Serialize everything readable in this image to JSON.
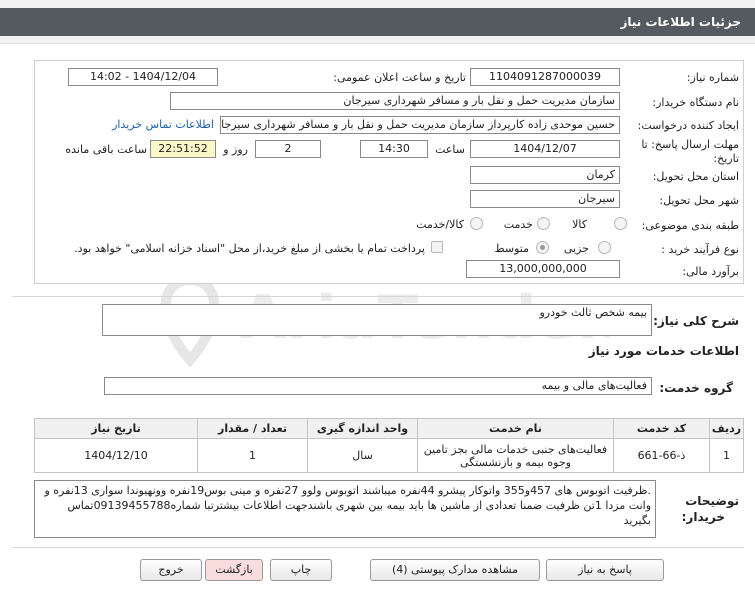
{
  "header": {
    "title": "جزئیات اطلاعات نیاز"
  },
  "fields": {
    "need_number_label": "شماره نیاز:",
    "need_number": "1104091287000039",
    "announce_label": "تاریخ و ساعت اعلان عمومی:",
    "announce_value": "1404/12/04 - 14:02",
    "buyer_org_label": "نام دستگاه خریدار:",
    "buyer_org": "سازمان مدیریت حمل و نقل بار و مسافر شهرداری سیرجان",
    "creator_label": "ایجاد کننده درخواست:",
    "creator": "حسین  موحدی زاده کارپرداز سازمان مدیریت حمل و نقل بار و مسافر شهرداری سیرجان",
    "contact_link": "اطلاعات تماس خریدار",
    "deadline_label_1": "مهلت ارسال پاسخ: تا",
    "deadline_label_2": "تاریخ:",
    "deadline_date": "1404/12/07",
    "hour_label": "ساعت",
    "deadline_time": "14:30",
    "days_value": "2",
    "days_label": "روز و",
    "remaining_time": "22:51:52",
    "remaining_label": "ساعت باقی مانده",
    "province_label": "استان محل تحویل:",
    "province": "کرمان",
    "city_label": "شهر محل تحویل:",
    "city": "سیرجان",
    "category_label": "طبقه بندی موضوعی:",
    "category_options": [
      "کالا",
      "خدمت",
      "کالا/خدمت"
    ],
    "process_label": "نوع فرآیند خرید :",
    "process_options": [
      "جزیی",
      "متوسط"
    ],
    "payment_note": "پرداخت تمام یا بخشی از مبلغ خرید،از محل \"اسناد خزانه اسلامی\" خواهد بود.",
    "budget_label": "برآورد مالی:",
    "budget": "13,000,000,000"
  },
  "summary": {
    "label": "شرح کلی نیاز:",
    "value": "بیمه شخص ثالث خودرو"
  },
  "services": {
    "section_title": "اطلاعات خدمات مورد نیاز",
    "group_label": "گروه خدمت:",
    "group_value": "فعالیت‌های مالی و بیمه",
    "columns": [
      "ردیف",
      "کد خدمت",
      "نام خدمت",
      "واحد اندازه گیری",
      "تعداد / مقدار",
      "تاریخ نیاز"
    ],
    "rows": [
      {
        "row": "1",
        "code": "ذ-66-661",
        "name": "فعالیت‌های جنبی خدمات مالی بجز تامین وجوه بیمه و بازنشستگی",
        "unit": "سال",
        "qty": "1",
        "date": "1404/12/10"
      }
    ]
  },
  "buyer_notes": {
    "label_1": "توضیحات",
    "label_2": "خریدار:",
    "text": ".ظرفیت اتوبوس های 457و355  واتوکار پیشرو 44نفره میباشند اتوبوس ولوو 27نفره و مینی بوس19نفره وونهیوندا سواری 13نفره و وانت مزدا 1تن ظرفیت ضمنا تعدادی از ماشین ها باید بیمه بین شهری باشندجهت اطلاعات بیشترتبا شماره09139455788تماس بگیرید"
  },
  "buttons": {
    "reply": "پاسخ به نیاز",
    "attachments": "مشاهده مدارک پیوستی (4)",
    "print": "چاپ",
    "back": "بازگشت",
    "exit": "خروج"
  },
  "watermark": {
    "text": "AriaTender.neT"
  }
}
